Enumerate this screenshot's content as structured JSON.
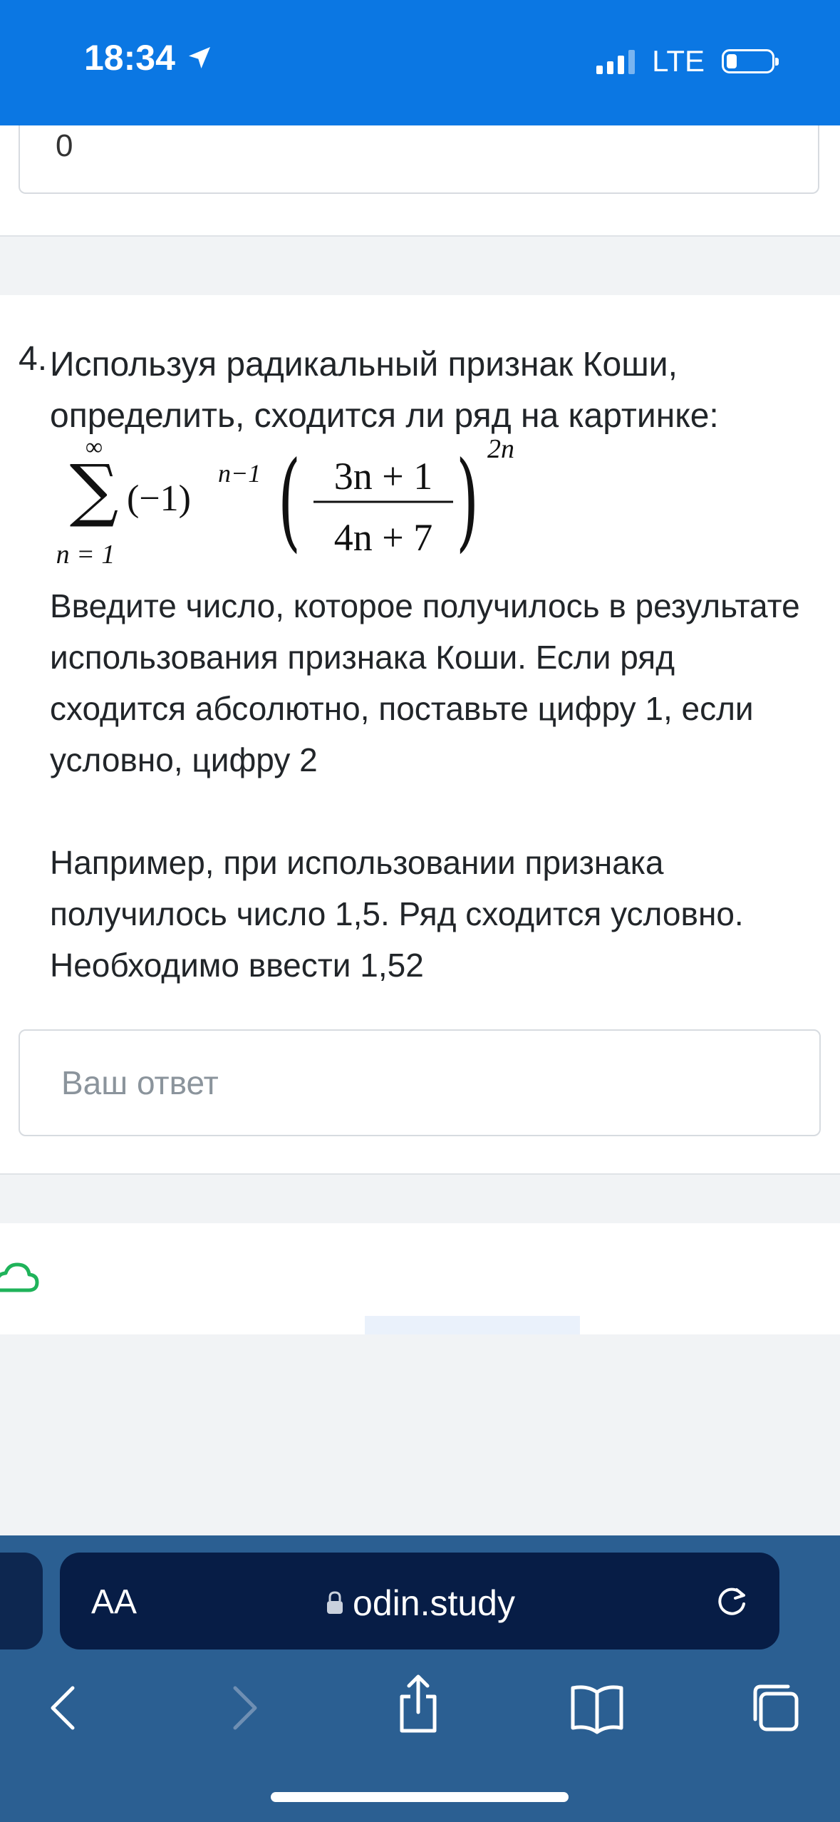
{
  "status_bar": {
    "time": "18:34",
    "network": "LTE"
  },
  "previous_question": {
    "answer_value": "0"
  },
  "question": {
    "number": "4.",
    "title": "Используя радикальный признак Коши, определить, сходится ли ряд на картинке:",
    "formula": {
      "sum_upper": "∞",
      "sum_lower": "n = 1",
      "base": "(−1)",
      "base_exponent": "n−1",
      "numerator": "3n + 1",
      "denominator": "4n + 7",
      "outer_exponent": "2n"
    },
    "instructions": "Введите число, которое получилось в результате использования признака Коши. Если ряд сходится абсолютно, поставьте цифру 1, если условно, цифру 2",
    "example": "Например, при использовании признака получилось число 1,5. Ряд сходится условно. Необходимо ввести 1,52",
    "answer_placeholder": "Ваш ответ"
  },
  "browser": {
    "text_size_label": "AA",
    "url": "odin.study"
  },
  "colors": {
    "status_bar": "#0b77e3",
    "browser_bar": "#2b5f92",
    "url_bar": "#071d46",
    "cloud_icon": "#1fb35a"
  }
}
